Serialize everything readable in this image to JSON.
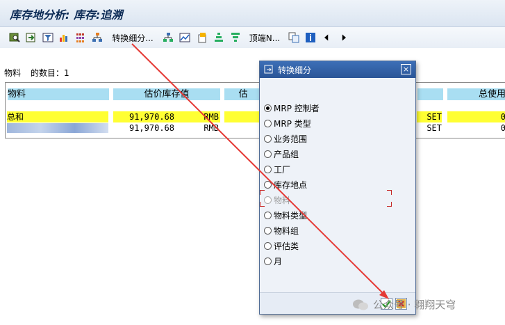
{
  "window": {
    "title": "库存地分析: 库存:追溯"
  },
  "toolbar": {
    "icons": [
      "drilldown-icon",
      "export-icon",
      "filter-icon",
      "chart-icon",
      "grid-icon",
      "hierarchy-icon",
      "hierarchy-icon",
      "line-chart-icon",
      "document-icon",
      "sort-up-icon",
      "sort-down-icon",
      "info-icon"
    ],
    "switch_label": "转换细分...",
    "top_n_label": "顶端N..."
  },
  "summary": {
    "material_label": "物料",
    "count_label": "的数目：1"
  },
  "table": {
    "columns": [
      "物料",
      "估价库存值",
      "估",
      "",
      "总使用"
    ],
    "rows": [
      {
        "material": "总和",
        "value": "91,970.68",
        "currency": "RMB",
        "unit": "SET",
        "trailing": "0"
      },
      {
        "material": "",
        "value": "91,970.68",
        "currency": "RMB",
        "unit": "SET",
        "trailing": "0"
      }
    ]
  },
  "dialog": {
    "title": "转换细分",
    "close_label": "×",
    "options": [
      {
        "label": "MRP 控制者",
        "selected": true,
        "disabled": false
      },
      {
        "label": "MRP 类型",
        "selected": false,
        "disabled": false
      },
      {
        "label": "业务范围",
        "selected": false,
        "disabled": false
      },
      {
        "label": "产品组",
        "selected": false,
        "disabled": false
      },
      {
        "label": "工厂",
        "selected": false,
        "disabled": false
      },
      {
        "label": "库存地点",
        "selected": false,
        "disabled": false
      },
      {
        "label": "物料",
        "selected": false,
        "disabled": true
      },
      {
        "label": "物料类型",
        "selected": false,
        "disabled": false
      },
      {
        "label": "物料组",
        "selected": false,
        "disabled": false
      },
      {
        "label": "评估类",
        "selected": false,
        "disabled": false
      },
      {
        "label": "月",
        "selected": false,
        "disabled": false
      }
    ]
  },
  "watermark": {
    "text": "公众号 · 翱翔天穹"
  },
  "colors": {
    "header_label_bg": "#a9def2",
    "total_row_bg": "#ffff33",
    "dialog_title_bg": "#2a5597",
    "arrow": "#e53935"
  }
}
